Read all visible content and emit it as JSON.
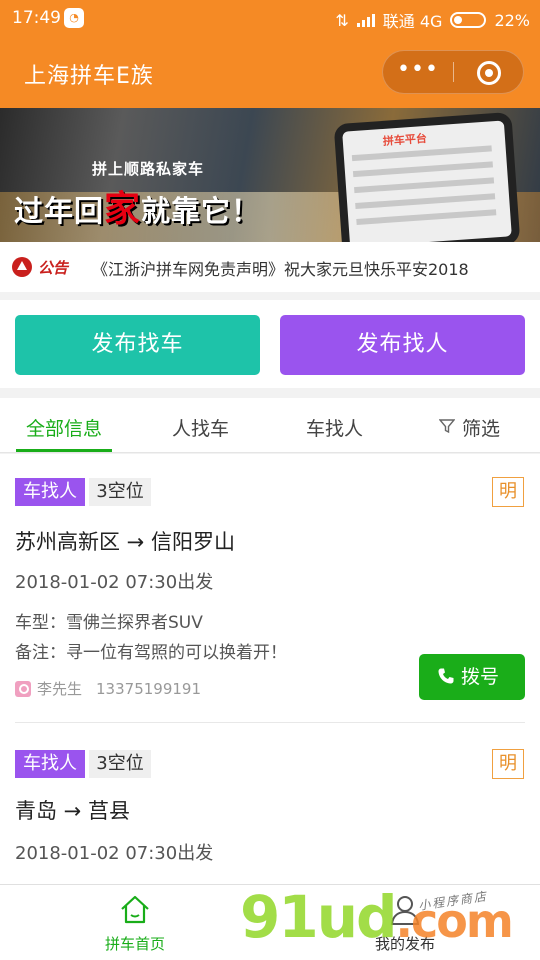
{
  "status_bar": {
    "time": "17:49",
    "carrier": "联通 4G",
    "battery": "22%"
  },
  "header": {
    "title": "上海拼车E族",
    "more_label": "•••"
  },
  "banner": {
    "tagline": "拼上顺路私家车",
    "headline_start": "过年回",
    "headline_highlight": "家",
    "headline_end": "就靠它！",
    "phone_title": "拼车平台"
  },
  "notice": {
    "label": "公告",
    "text": "《江浙沪拼车网免责声明》祝大家元旦快乐平安2018"
  },
  "actions": {
    "find_car": "发布找车",
    "find_people": "发布找人"
  },
  "tabs": {
    "all": "全部信息",
    "people_find_car": "人找车",
    "car_find_people": "车找人",
    "filter": "筛选"
  },
  "listings": [
    {
      "type": "车找人",
      "seats": "3空位",
      "ming": "明",
      "route": "苏州高新区 → 信阳罗山",
      "depart": "2018-01-02 07:30出发",
      "car_model": "车型：雪佛兰探界者SUV",
      "remark": "备注：寻一位有驾照的可以换着开！",
      "contact": "李先生",
      "phone": "13375199191",
      "call_label": "拨号"
    },
    {
      "type": "车找人",
      "seats": "3空位",
      "ming": "明",
      "route": "青岛 → 莒县",
      "depart": "2018-01-02 07:30出发"
    }
  ],
  "bottom_nav": {
    "home": "拼车首页",
    "mine": "我的发布"
  },
  "watermark": {
    "brand": "91ud",
    "tld": ".com",
    "sub": "小程序商店"
  },
  "colors": {
    "brand_orange": "#f58a25",
    "teal": "#1ec3a9",
    "purple": "#9a54ee",
    "green": "#19ad19",
    "notice_red": "#c9201d"
  }
}
